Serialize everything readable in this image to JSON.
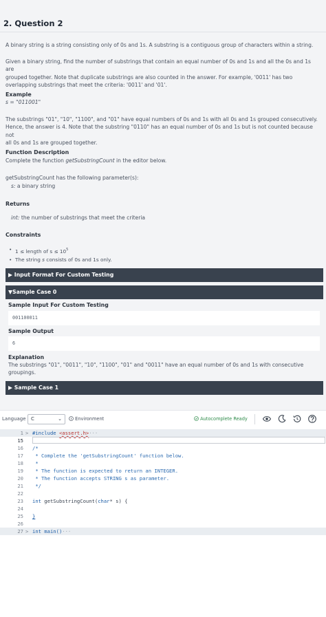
{
  "question": {
    "title": "2. Question 2",
    "intro": "A binary string is a string consisting only of 0s and 1s. A substring is a contiguous group of characters within a string.",
    "task_line1": "Given a binary string, find the number of substrings that contain an equal number of 0s and 1s and all the 0s and 1s are",
    "task_line2": "grouped together. Note that duplicate substrings are also counted in the answer. For example, '0011' has two",
    "task_line3": "overlapping substrings that meet the criteria: '0011' and '01'.",
    "example_heading": "Example",
    "example_value": "s = \"011001\"",
    "example_line1": "The substrings \"01\", \"10\", \"1100\", and \"01\" have equal numbers of 0s and 1s with all 0s and 1s grouped consecutively.",
    "example_line2": "Hence, the answer is 4. Note that the substring \"0110\" has an equal number of 0s and 1s but is not counted because not",
    "example_line3": "all 0s and 1s are grouped together.",
    "func_heading": "Function Description",
    "func_line_pre": "Complete the function ",
    "func_name": "getSubstringCount",
    "func_line_post": " in the editor below.",
    "params_line": "getSubstringCount has the following parameter(s):",
    "param_name": "s:",
    "param_desc": " a binary string",
    "returns_heading": "Returns",
    "returns_type": "int:",
    "returns_desc": " the number of substrings that meet the criteria",
    "constraints_heading": "Constraints",
    "constraint1_pre": "1 ≤ length of s ≤ 10",
    "constraint1_sup": "5",
    "constraint2_pre": "The string ",
    "constraint2_var": "s",
    "constraint2_post": " consists of 0s and 1s only."
  },
  "sections": {
    "input_format": "▶ Input Format For Custom Testing",
    "sample0": "▼Sample Case 0",
    "sample_input_heading": "Sample Input For Custom Testing",
    "sample_input_value": "001100011",
    "sample_output_heading": "Sample Output",
    "sample_output_value": "6",
    "explanation_heading": "Explanation",
    "explanation_line1": "The substrings \"01\", \"0011\", \"10\", \"1100\", \"01\" and \"0011\" have an equal number of 0s and 1s with consecutive",
    "explanation_line2": "groupings.",
    "sample1": "▶ Sample Case 1"
  },
  "toolbar": {
    "language_label": "Language",
    "language_value": "C",
    "environment_label": "Environment",
    "autocomplete_label": "Autocomplete Ready",
    "icons": [
      "eye-icon",
      "moon-icon",
      "history-icon",
      "help-icon"
    ]
  },
  "editor": {
    "lines": [
      {
        "num": "1",
        "fold": ">"
      },
      {
        "num": "15",
        "fold": ""
      },
      {
        "num": "16",
        "fold": "",
        "text": "/*"
      },
      {
        "num": "17",
        "fold": "",
        "text": " * Complete the 'getSubstringCount' function below."
      },
      {
        "num": "18",
        "fold": "",
        "text": " *"
      },
      {
        "num": "19",
        "fold": "",
        "text": " * The function is expected to return an INTEGER."
      },
      {
        "num": "20",
        "fold": "",
        "text": " * The function accepts STRING s as parameter."
      },
      {
        "num": "21",
        "fold": "",
        "text": " */"
      },
      {
        "num": "22",
        "fold": "",
        "text": ""
      },
      {
        "num": "23",
        "fold": "",
        "text": ""
      },
      {
        "num": "24",
        "fold": "",
        "text": ""
      },
      {
        "num": "25",
        "fold": "",
        "text": "}"
      },
      {
        "num": "26",
        "fold": "",
        "text": ""
      },
      {
        "num": "27",
        "fold": ">"
      }
    ],
    "include_kw": "#include ",
    "include_hdr": "<assert.h>",
    "collapsed": "···",
    "sig_kw": "int",
    "sig_name": " getSubstringCount(",
    "sig_type": "char",
    "sig_rest": "* s) {",
    "main_kw": "int",
    "main_name": " main()"
  },
  "colors": {
    "dark_bar": "#39424e",
    "autocomplete_green": "#2e8b4a",
    "keyword_blue": "#1f5fa8",
    "string_red": "#b8322e"
  }
}
